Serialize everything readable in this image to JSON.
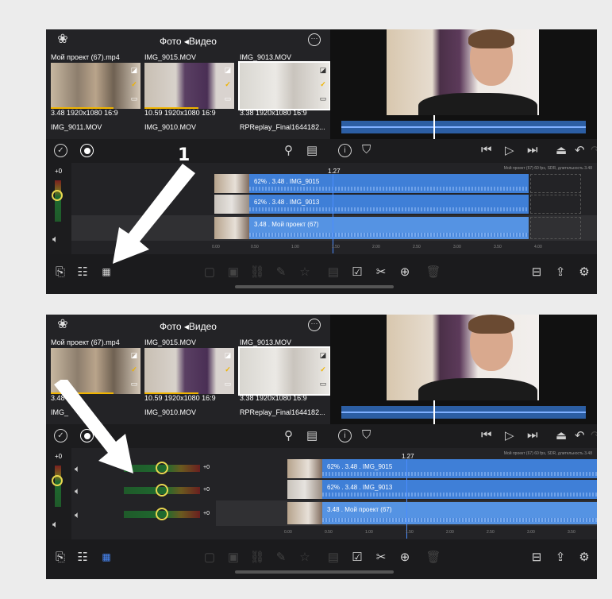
{
  "browser": {
    "title": "Фото ◂Видео",
    "clips": [
      {
        "name": "Мой проект (67).mp4",
        "duration": "3.48",
        "resolution": "1920x1080",
        "ratio": "16:9",
        "thumb": "people",
        "selected": false
      },
      {
        "name": "IMG_9015.MOV",
        "duration": "10.59",
        "resolution": "1920x1080",
        "ratio": "16:9",
        "thumb": "room",
        "selected": false
      },
      {
        "name": "IMG_9013.MOV",
        "duration": "3.38",
        "resolution": "1920x1080",
        "ratio": "16:9",
        "thumb": "window",
        "selected": true
      }
    ],
    "second_row": [
      "IMG_9011.MOV",
      "IMG_9010.MOV",
      "RPReplay_Final1644182..."
    ],
    "second_row_panel2": [
      "IMG_",
      "IMG_9010.MOV",
      "RPReplay_Final1644182..."
    ]
  },
  "timeline": {
    "gain_top": "+0",
    "time": "1.27",
    "info": "Мой проект (67) 60 fps, SDR, длительность 3.48",
    "tracks": [
      {
        "label": "62% . 3.48 . IMG_9015"
      },
      {
        "label": "62% . 3.48 . IMG_9013"
      },
      {
        "label": "3.48 . Мой проект (67)"
      }
    ],
    "ruler": [
      "0.00",
      "0.50",
      "1.00",
      "1.50",
      "2.00",
      "2.50",
      "3.00",
      "3.50",
      "4.00"
    ]
  },
  "mixer": {
    "rows": [
      {
        "value": "+0"
      },
      {
        "value": "+0"
      },
      {
        "value": "+0"
      }
    ]
  },
  "annotations": {
    "step_label": "1"
  },
  "colors": {
    "accent": "#4a8cff",
    "track": "#3f7fd7",
    "selection": "#f0b400"
  }
}
